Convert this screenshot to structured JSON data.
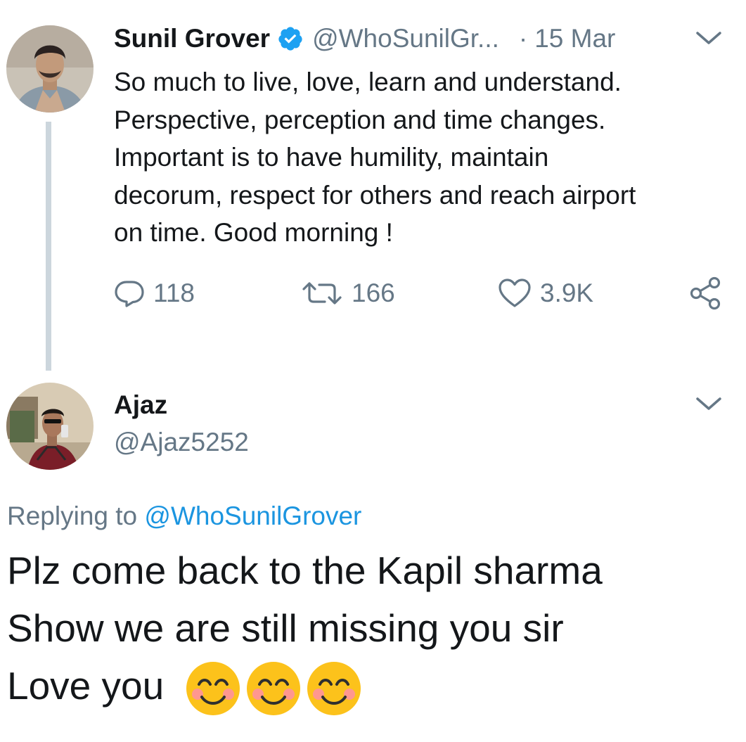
{
  "tweet": {
    "author_name": "Sunil Grover",
    "handle": "@WhoSunilGr...",
    "separator": "·",
    "date": "15 Mar",
    "text": "So much to live, love, learn and understand.\nPerspective, perception and time changes.\nImportant is to have humility, maintain\ndecorum, respect for others and reach airport\non time. Good morning !",
    "replies_count": "118",
    "retweets_count": "166",
    "likes_count": "3.9K"
  },
  "reply": {
    "author_name": "Ajaz",
    "handle": "@Ajaz5252",
    "replying_prefix": "Replying to",
    "replying_to": "@WhoSunilGrover",
    "text_line1": "Plz come back to the Kapil sharma",
    "text_line2": "Show we are still missing you sir",
    "text_line3": "Love you",
    "emoji": [
      "smiling-face-with-smiling-eyes",
      "smiling-face-with-smiling-eyes",
      "smiling-face-with-smiling-eyes"
    ]
  },
  "colors": {
    "text": "#14171a",
    "secondary": "#657786",
    "link": "#1b95e0",
    "verified": "#1da1f2",
    "thread_line": "#ccd6dd"
  },
  "icons": {
    "reply": "reply-icon",
    "retweet": "retweet-icon",
    "like": "heart-icon",
    "share": "share-icon",
    "menu": "chevron-down-icon",
    "verified": "verified-badge-icon"
  }
}
